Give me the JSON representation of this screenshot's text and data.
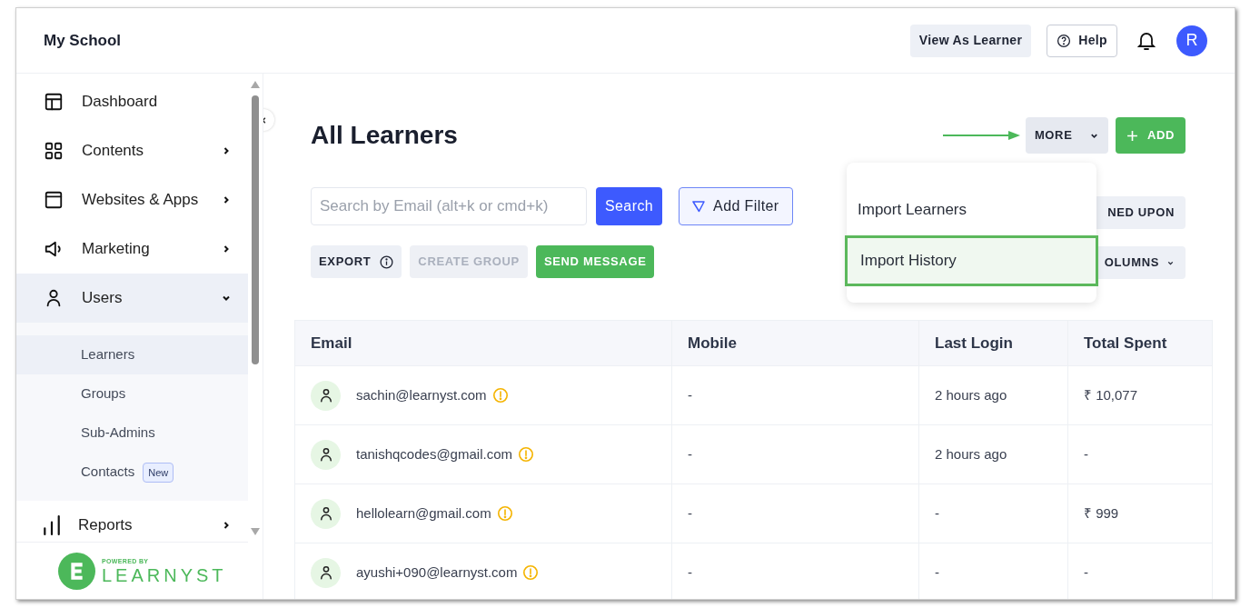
{
  "header": {
    "school": "My School",
    "view_as": "View As Learner",
    "help": "Help",
    "avatar": "R"
  },
  "sidebar": {
    "items": [
      {
        "label": "Dashboard",
        "expanded": false,
        "selected": false,
        "has_arrow": false
      },
      {
        "label": "Contents",
        "expanded": false,
        "selected": false,
        "has_arrow": true
      },
      {
        "label": "Websites & Apps",
        "expanded": false,
        "selected": false,
        "has_arrow": true
      },
      {
        "label": "Marketing",
        "expanded": false,
        "selected": false,
        "has_arrow": true
      },
      {
        "label": "Users",
        "expanded": true,
        "selected": true,
        "has_arrow": true,
        "children": [
          {
            "label": "Learners",
            "selected": true
          },
          {
            "label": "Groups",
            "selected": false
          },
          {
            "label": "Sub-Admins",
            "selected": false
          },
          {
            "label": "Contacts",
            "selected": false,
            "badge": "New"
          }
        ]
      },
      {
        "label": "Reports",
        "expanded": false,
        "selected": false,
        "has_arrow": true
      }
    ],
    "footer": {
      "powered_by": "POWERED BY",
      "brand": "LEARNYST"
    }
  },
  "page": {
    "title": "All Learners",
    "search": {
      "placeholder": "Search by Email (alt+k or cmd+k)"
    },
    "search_button": "Search",
    "filter_button": "Add Filter",
    "actions": [
      {
        "label": "EXPORT",
        "kind": "info",
        "disabled": false
      },
      {
        "label": "CREATE GROUP",
        "kind": "plain",
        "disabled": true
      },
      {
        "label": "SEND MESSAGE",
        "kind": "primary",
        "disabled": false
      }
    ],
    "more_button": "MORE",
    "add_button": "ADD",
    "partial_buttons": [
      {
        "label": "NED UPON",
        "kind": "plain"
      },
      {
        "label": "OLUMNS",
        "kind": "dropdown"
      }
    ],
    "dropdown": [
      {
        "label": "Import Learners",
        "highlighted": false
      },
      {
        "label": "Import History",
        "highlighted": true
      }
    ]
  },
  "table": {
    "columns": [
      "Email",
      "Mobile",
      "Last Login",
      "Total Spent"
    ],
    "rows": [
      {
        "email": "sachin@learnyst.com",
        "mobile": "-",
        "last_login": "2 hours ago",
        "total_spent": "₹ 10,077"
      },
      {
        "email": "tanishqcodes@gmail.com",
        "mobile": "-",
        "last_login": "2 hours ago",
        "total_spent": "-"
      },
      {
        "email": "hellolearn@gmail.com",
        "mobile": "-",
        "last_login": "-",
        "total_spent": "₹ 999"
      },
      {
        "email": "ayushi+090@learnyst.com",
        "mobile": "-",
        "last_login": "-",
        "total_spent": "-"
      }
    ]
  }
}
